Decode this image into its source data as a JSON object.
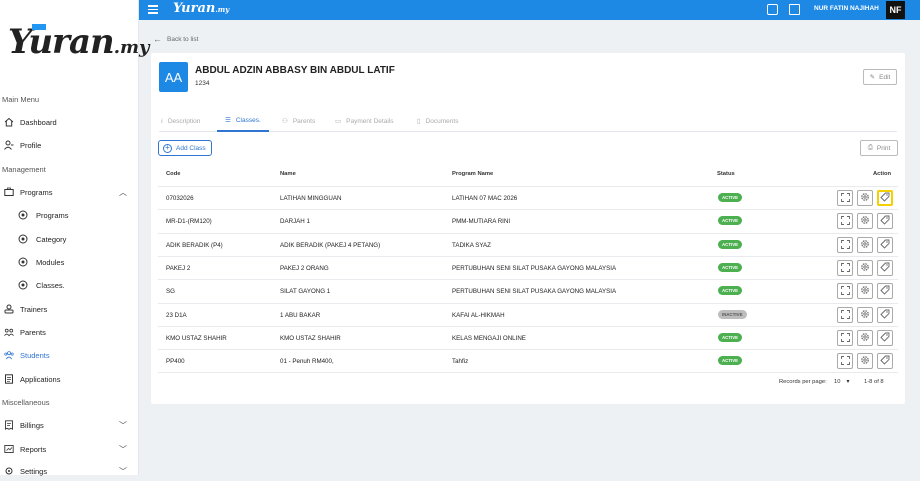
{
  "brand": {
    "logo": "Yuran",
    "logo_tld": ".my",
    "top_logo": "Yuran",
    "top_logo_tld": ".my"
  },
  "user": {
    "name": "NUR FATIN NAJIHAH",
    "initials": "NF"
  },
  "sidebar": {
    "main_menu": "Main Menu",
    "management": "Management",
    "miscellaneous": "Miscellaneous",
    "items": {
      "dashboard": "Dashboard",
      "profile": "Profile",
      "programs": "Programs",
      "programs_sub": "Programs",
      "category": "Category",
      "modules": "Modules",
      "classes": "Classes.",
      "trainers": "Trainers",
      "parents": "Parents",
      "students": "Students",
      "applications": "Applications",
      "billings": "Billings",
      "reports": "Reports",
      "settings": "Settings"
    }
  },
  "back_label": "Back to list",
  "student": {
    "initials": "AA",
    "name": "ABDUL ADZIN ABBASY BIN ABDUL LATIF",
    "id": "1234"
  },
  "edit_label": "Edit",
  "tabs": {
    "description": "Description",
    "classes": "Classes.",
    "parents": "Parents",
    "payment": "Payment Details",
    "documents": "Documents"
  },
  "add_class_label": "Add Class",
  "print_label": "Print",
  "table": {
    "headers": {
      "code": "Code",
      "name": "Name",
      "program": "Program Name",
      "status": "Status",
      "action": "Action"
    },
    "rows": [
      {
        "code": "07032026",
        "name": "LATIHAN MINGGUAN",
        "program": "LATIHAN 07 MAC 2026",
        "status": "ACTIVE"
      },
      {
        "code": "MR-D1-(RM120)",
        "name": "DARJAH 1",
        "program": "PMM-MUTIARA RINI",
        "status": "ACTIVE"
      },
      {
        "code": "ADIK BERADIK (P4)",
        "name": "ADIK BERADIK (PAKEJ 4 PETANG)",
        "program": "TADIKA SYAZ",
        "status": "ACTIVE"
      },
      {
        "code": "PAKEJ 2",
        "name": "PAKEJ 2 ORANG",
        "program": "PERTUBUHAN SENI SILAT PUSAKA GAYONG MALAYSIA",
        "status": "ACTIVE"
      },
      {
        "code": "SG",
        "name": "SILAT GAYONG 1",
        "program": "PERTUBUHAN SENI SILAT PUSAKA GAYONG MALAYSIA",
        "status": "ACTIVE"
      },
      {
        "code": "23 D1A",
        "name": "1 ABU BAKAR",
        "program": "KAFAI AL-HIKMAH",
        "status": "INACTIVE"
      },
      {
        "code": "KMO USTAZ SHAHIR",
        "name": "KMO USTAZ SHAHIR",
        "program": "KELAS MENGAJI ONLINE",
        "status": "ACTIVE"
      },
      {
        "code": "PP400",
        "name": "01 - Penuh RM400,",
        "program": "Tahfiz",
        "status": "ACTIVE"
      }
    ]
  },
  "pagination": {
    "records_label": "Records per page:",
    "per_page": "10",
    "range": "1-8 of 8"
  },
  "colors": {
    "primary": "#1e88e5",
    "active_badge": "#4caf50",
    "inactive_badge": "#bdbdbd",
    "highlight": "#f5d000"
  }
}
